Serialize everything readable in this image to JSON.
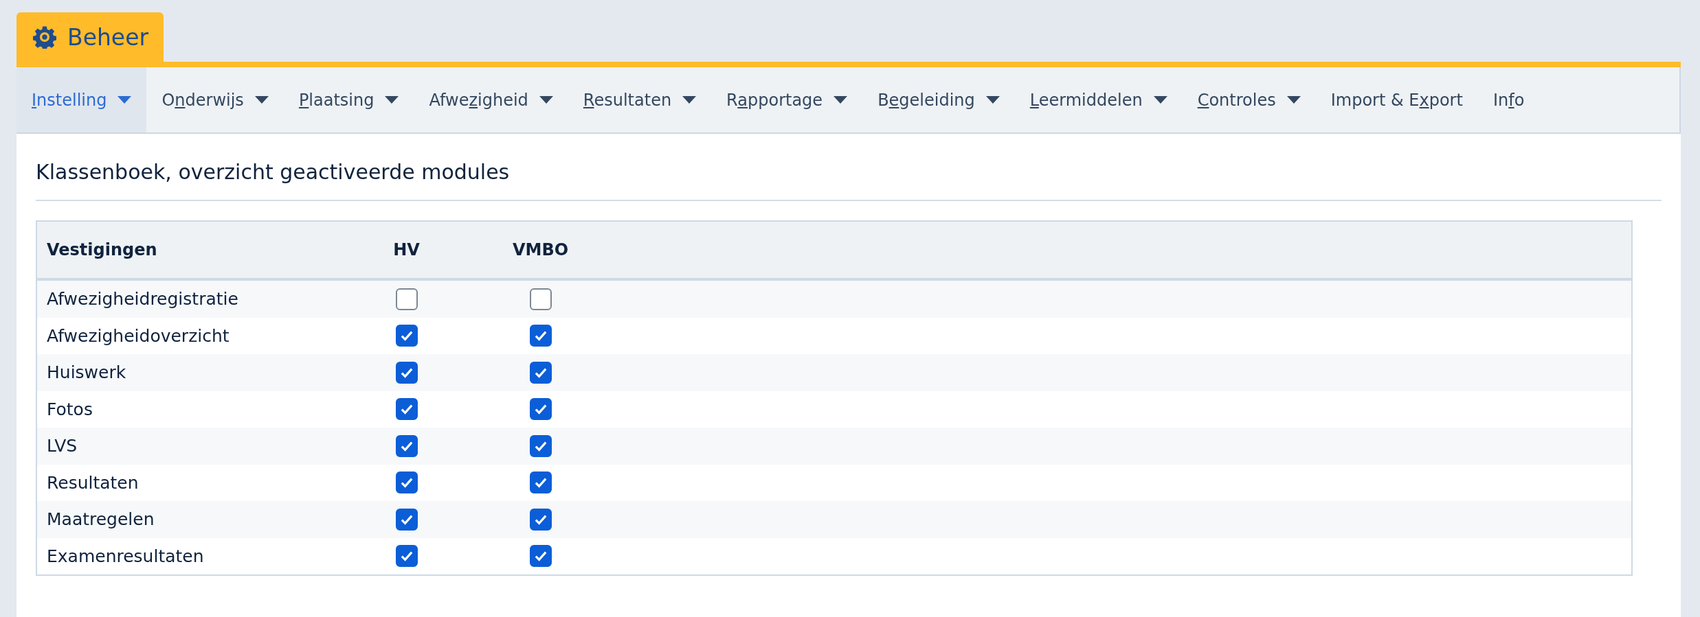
{
  "tab": {
    "label": "Beheer"
  },
  "menu": [
    {
      "key": "I",
      "after": "nstelling",
      "dropdown": true,
      "selected": true
    },
    {
      "before": "O",
      "key": "n",
      "after": "derwijs",
      "dropdown": true,
      "selected": false
    },
    {
      "key": "P",
      "after": "laatsing",
      "dropdown": true,
      "selected": false
    },
    {
      "before": "Afwe",
      "key": "z",
      "after": "igheid",
      "dropdown": true,
      "selected": false
    },
    {
      "key": "R",
      "after": "esultaten",
      "dropdown": true,
      "selected": false
    },
    {
      "before": "R",
      "key": "a",
      "after": "pportage",
      "dropdown": true,
      "selected": false
    },
    {
      "before": "B",
      "key": "e",
      "after": "geleiding",
      "dropdown": true,
      "selected": false
    },
    {
      "key": "L",
      "after": "eermiddelen",
      "dropdown": true,
      "selected": false
    },
    {
      "key": "C",
      "after": "ontroles",
      "dropdown": true,
      "selected": false
    },
    {
      "before": "Import & E",
      "key": "x",
      "after": "port",
      "dropdown": false,
      "selected": false
    },
    {
      "before": "In",
      "key": "f",
      "after": "o",
      "dropdown": false,
      "selected": false
    }
  ],
  "page_title": "Klassenboek, overzicht geactiveerde modules",
  "table": {
    "columns": [
      "Vestigingen",
      "HV",
      "VMBO"
    ],
    "rows": [
      {
        "name": "Afwezigheidregistratie",
        "checks": [
          false,
          false
        ]
      },
      {
        "name": "Afwezigheidoverzicht",
        "checks": [
          true,
          true
        ]
      },
      {
        "name": "Huiswerk",
        "checks": [
          true,
          true
        ]
      },
      {
        "name": "Fotos",
        "checks": [
          true,
          true
        ]
      },
      {
        "name": "LVS",
        "checks": [
          true,
          true
        ]
      },
      {
        "name": "Resultaten",
        "checks": [
          true,
          true
        ]
      },
      {
        "name": "Maatregelen",
        "checks": [
          true,
          true
        ]
      },
      {
        "name": "Examenresultaten",
        "checks": [
          true,
          true
        ]
      }
    ]
  }
}
